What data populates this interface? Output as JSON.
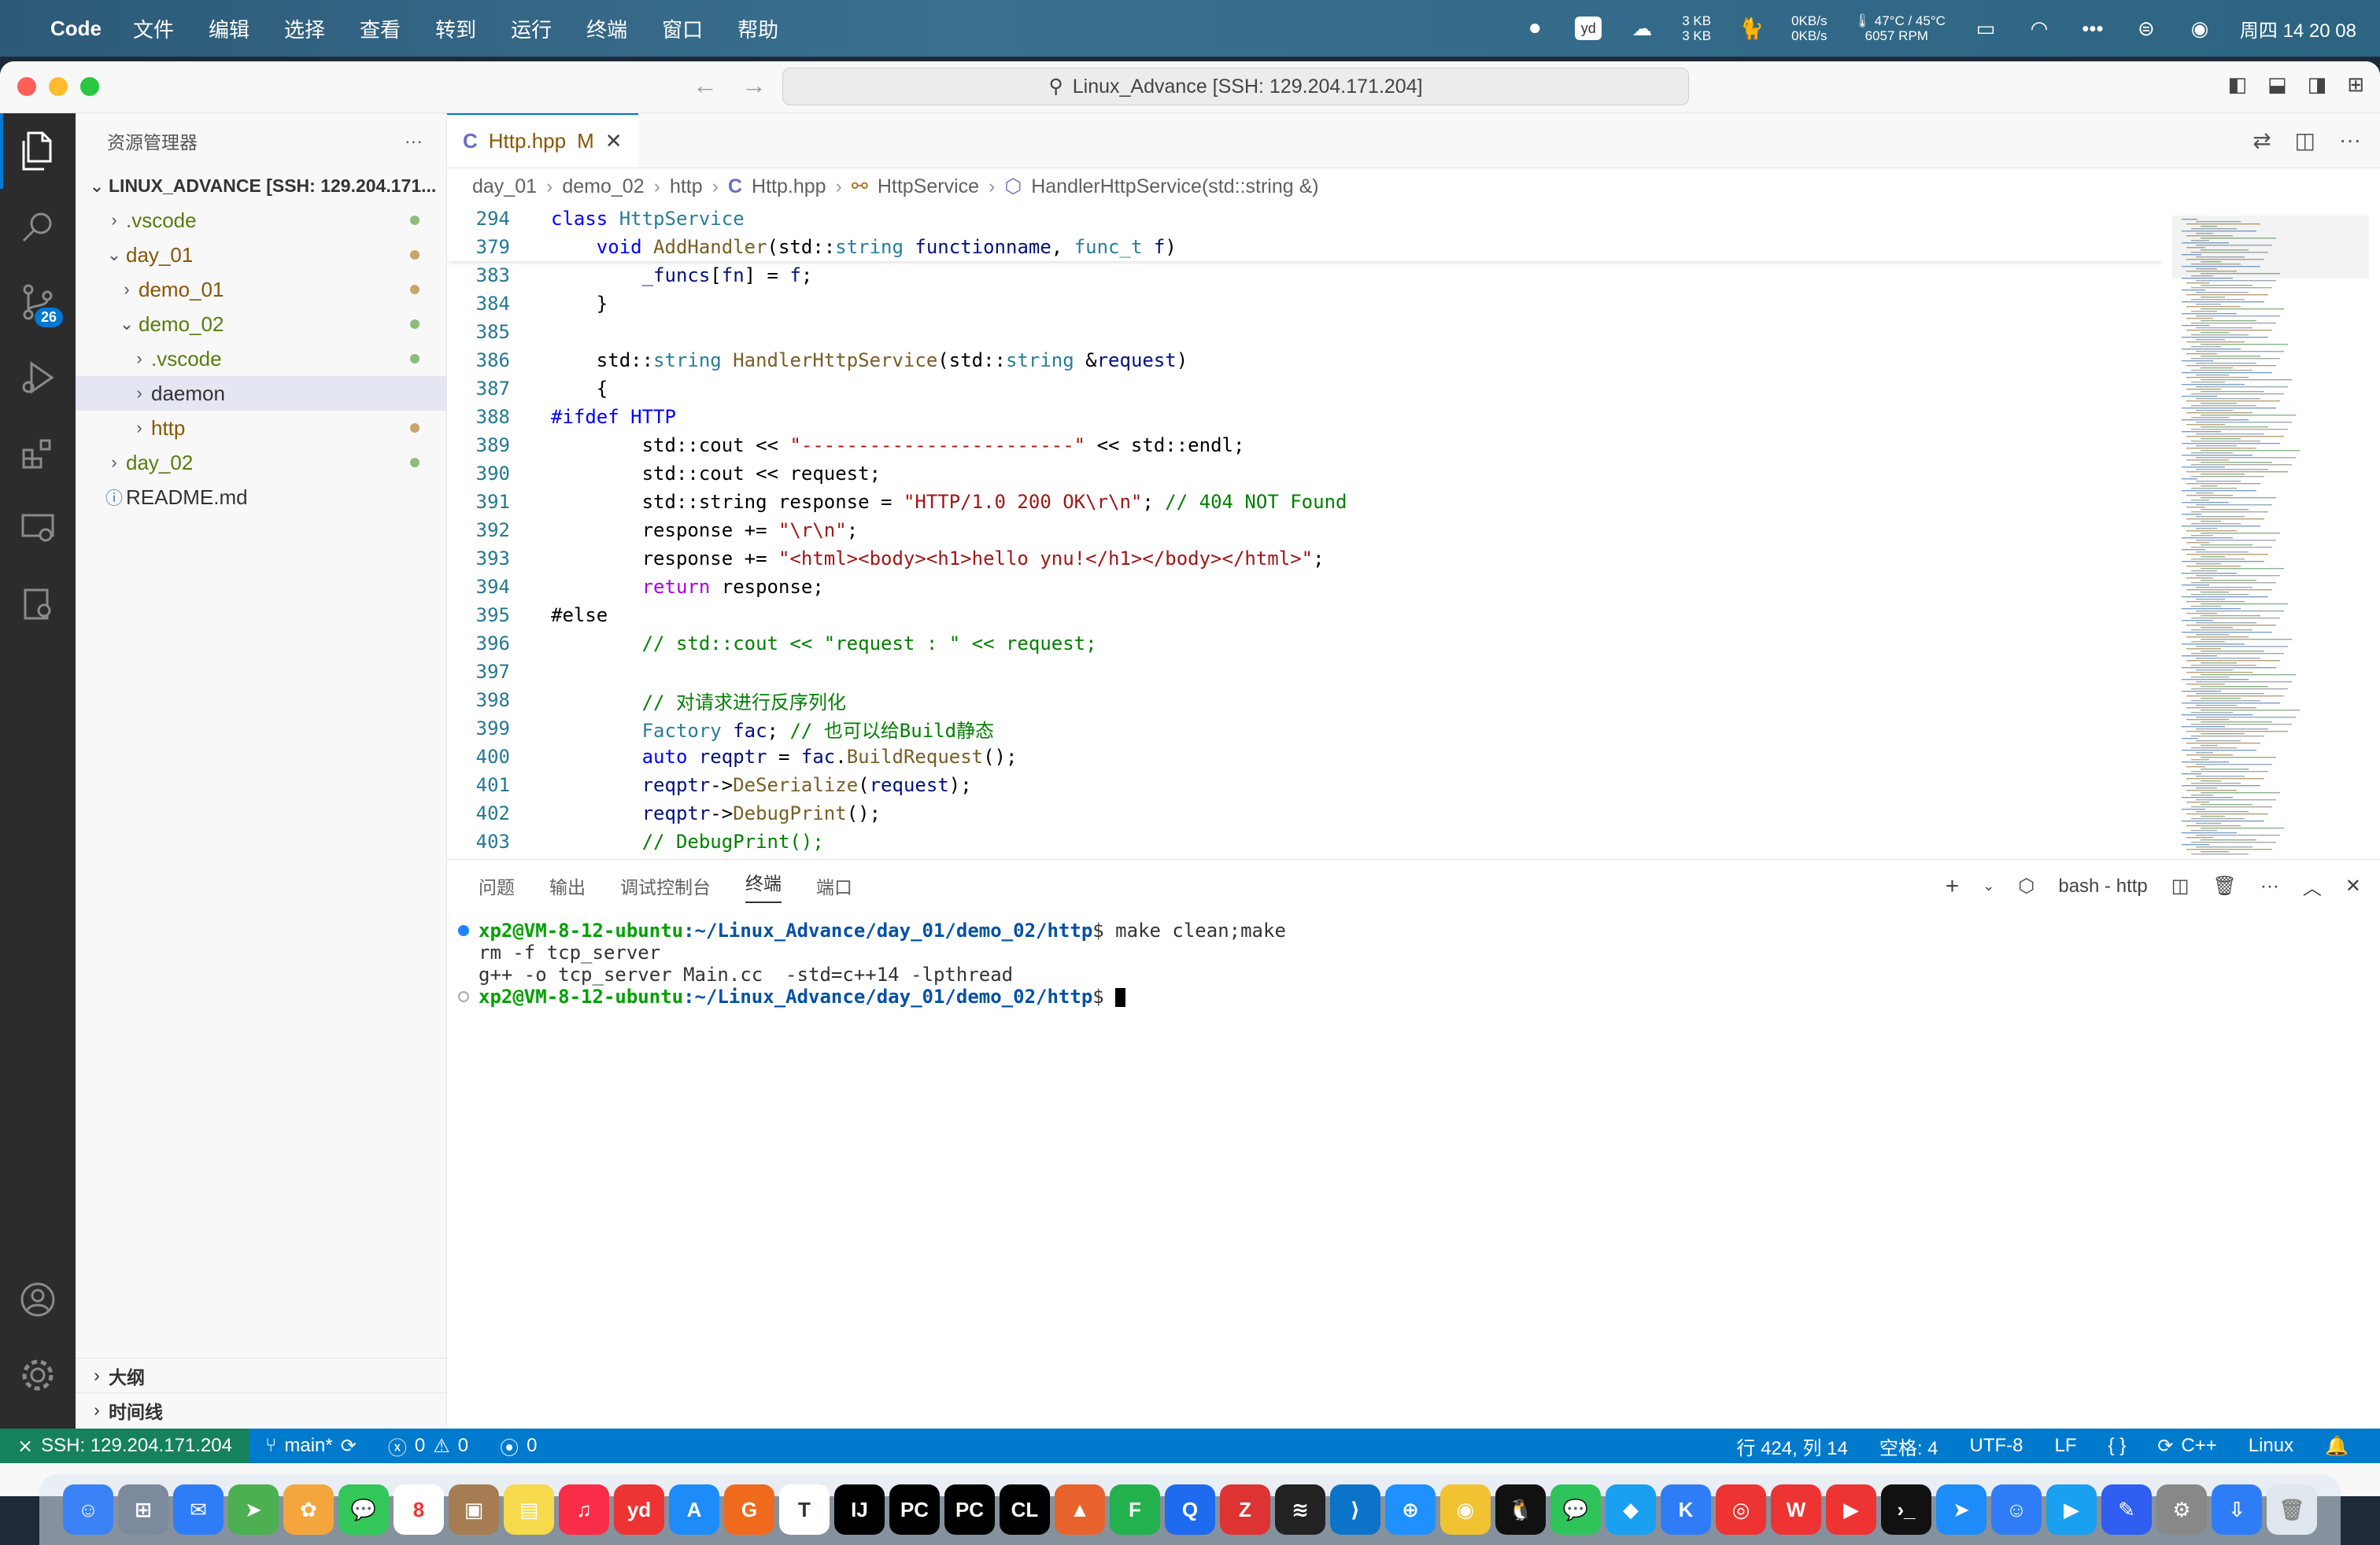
{
  "menubar": {
    "app_name": "Code",
    "items": [
      "文件",
      "编辑",
      "选择",
      "查看",
      "转到",
      "运行",
      "终端",
      "窗口",
      "帮助"
    ],
    "net_up": "3 KB",
    "net_down": "3 KB",
    "speed_up": "0KB/s",
    "speed_down": "0KB/s",
    "temp": "47°C / 45°C",
    "rpm": "6057 RPM",
    "datetime": "周四 14 20 08"
  },
  "titlebar": {
    "command_center": "Linux_Advance [SSH: 129.204.171.204]"
  },
  "activity": {
    "scm_badge": "26"
  },
  "sidebar": {
    "title": "资源管理器",
    "more": "···",
    "root": "LINUX_ADVANCE [SSH: 129.204.171...",
    "items": [
      {
        "label": ".vscode",
        "chevron": "›"
      },
      {
        "label": "day_01",
        "chevron": "⌄"
      },
      {
        "label": "demo_01",
        "chevron": "›"
      },
      {
        "label": "demo_02",
        "chevron": "⌄"
      },
      {
        "label": ".vscode",
        "chevron": "›"
      },
      {
        "label": "daemon",
        "chevron": "›"
      },
      {
        "label": "http",
        "chevron": "›"
      },
      {
        "label": "day_02",
        "chevron": "›"
      },
      {
        "label": "README.md",
        "chevron": "ⓘ"
      }
    ],
    "outline": "大纲",
    "timeline": "时间线"
  },
  "editor": {
    "tab_label": "Http.hpp",
    "tab_modified": "M",
    "breadcrumb": [
      "day_01",
      "demo_02",
      "http",
      "Http.hpp",
      "HttpService",
      "HandlerHttpService(std::string &)"
    ]
  },
  "panel": {
    "tabs": [
      "问题",
      "输出",
      "调试控制台",
      "终端",
      "端口"
    ],
    "active_tab": "终端",
    "terminal_name": "bash - http",
    "prompt_user": "xp2@VM-8-12-ubuntu",
    "prompt_path": ":~/Linux_Advance/day_01/demo_02/http",
    "command1": "$ make clean;make",
    "output1": "rm -f tcp_server",
    "output2": "g++ -o tcp_server Main.cc  -std=c++14 -lpthread",
    "command2": "$ "
  },
  "statusbar": {
    "remote": "SSH: 129.204.171.204",
    "branch": "main*",
    "errors": "0",
    "warnings": "0",
    "ports": "0",
    "position": "行 424, 列 14",
    "spaces": "空格: 4",
    "encoding": "UTF-8",
    "eol": "LF",
    "language": "C++",
    "platform": "Linux"
  },
  "colors": {
    "accent": "#0078d4",
    "statusbar": "#007acc",
    "remote": "#16825d",
    "modified": "#895503",
    "added": "#587c0c"
  }
}
